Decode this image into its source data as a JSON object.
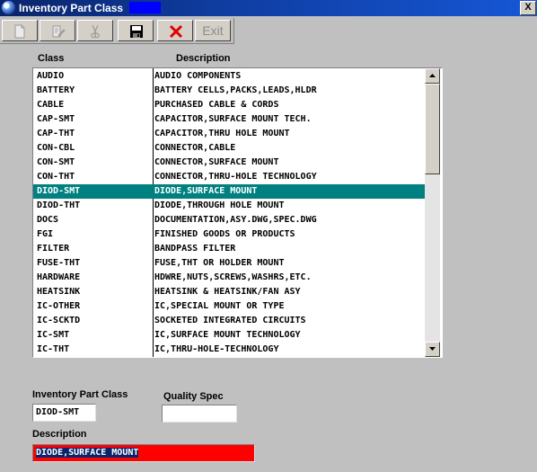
{
  "window": {
    "title": "Inventory Part Class",
    "close_label": "X"
  },
  "toolbar": {
    "buttons": [
      {
        "name": "new",
        "icon": "new-document-icon",
        "enabled": false
      },
      {
        "name": "edit",
        "icon": "edit-icon",
        "enabled": false
      },
      {
        "name": "cut",
        "icon": "scissors-icon",
        "enabled": false
      },
      {
        "name": "save",
        "icon": "floppy-disk-icon",
        "enabled": true
      },
      {
        "name": "delete",
        "icon": "red-x-icon",
        "enabled": true
      },
      {
        "name": "exit",
        "label": "Exit",
        "enabled": false
      }
    ]
  },
  "table": {
    "headers": {
      "class": "Class",
      "description": "Description"
    },
    "rows": [
      {
        "class": "AUDIO",
        "description": "AUDIO COMPONENTS"
      },
      {
        "class": "BATTERY",
        "description": "BATTERY CELLS,PACKS,LEADS,HLDR"
      },
      {
        "class": "CABLE",
        "description": "PURCHASED CABLE & CORDS"
      },
      {
        "class": "CAP-SMT",
        "description": "CAPACITOR,SURFACE MOUNT TECH."
      },
      {
        "class": "CAP-THT",
        "description": "CAPACITOR,THRU HOLE MOUNT"
      },
      {
        "class": "CON-CBL",
        "description": "CONNECTOR,CABLE"
      },
      {
        "class": "CON-SMT",
        "description": "CONNECTOR,SURFACE MOUNT"
      },
      {
        "class": "CON-THT",
        "description": "CONNECTOR,THRU-HOLE TECHNOLOGY"
      },
      {
        "class": "DIOD-SMT",
        "description": "DIODE,SURFACE MOUNT"
      },
      {
        "class": "DIOD-THT",
        "description": "DIODE,THROUGH HOLE MOUNT"
      },
      {
        "class": "DOCS",
        "description": "DOCUMENTATION,ASY.DWG,SPEC.DWG"
      },
      {
        "class": "FGI",
        "description": "FINISHED GOODS OR PRODUCTS"
      },
      {
        "class": "FILTER",
        "description": "BANDPASS FILTER"
      },
      {
        "class": "FUSE-THT",
        "description": "FUSE,THT OR HOLDER MOUNT"
      },
      {
        "class": "HARDWARE",
        "description": "HDWRE,NUTS,SCREWS,WASHRS,ETC."
      },
      {
        "class": "HEATSINK",
        "description": "HEATSINK & HEATSINK/FAN ASY"
      },
      {
        "class": "IC-OTHER",
        "description": "IC,SPECIAL MOUNT OR TYPE"
      },
      {
        "class": "IC-SCKTD",
        "description": "SOCKETED INTEGRATED CIRCUITS"
      },
      {
        "class": "IC-SMT",
        "description": "IC,SURFACE MOUNT TECHNOLOGY"
      },
      {
        "class": "IC-THT",
        "description": "IC,THRU-HOLE-TECHNOLOGY"
      }
    ],
    "selected_class": "DIOD-SMT"
  },
  "form": {
    "part_class_label": "Inventory Part Class",
    "part_class_value": "DIOD-SMT",
    "quality_spec_label": "Quality Spec",
    "quality_spec_value": "",
    "description_label": "Description",
    "description_value": "DIODE,SURFACE MOUNT"
  },
  "colors": {
    "title_bar": "#0a246a",
    "selected_row": "#008080",
    "description_field": "#ff0000",
    "text_highlight": "#0a246a"
  }
}
